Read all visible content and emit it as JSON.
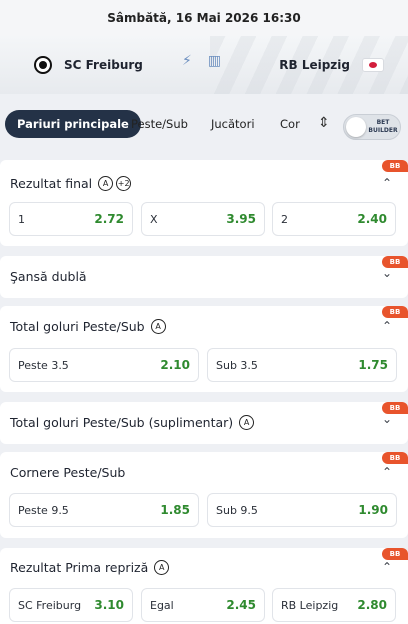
{
  "header": {
    "datetime": "Sâmbătă, 16 Mai 2026 16:30"
  },
  "match": {
    "home_team": "SC Freiburg",
    "away_team": "RB Leipzig",
    "icons": [
      "crest-freiburg-icon",
      "lightning-icon",
      "stats-icon",
      "crest-leipzig-icon"
    ]
  },
  "tabs": {
    "items": [
      "Pariuri principale",
      "Peste/Sub",
      "Jucători",
      "Cor"
    ],
    "active": "Pariuri principale",
    "toggle_label": "BET BUILDER",
    "toggle_on": false
  },
  "badge": "BB",
  "markets": [
    {
      "title": "Rezultat final",
      "expanded": true,
      "icons": [
        "circle-a-icon",
        "plus-2-icon"
      ],
      "plus_label": "+2",
      "outcomes": [
        {
          "label": "1",
          "odds": "2.72"
        },
        {
          "label": "X",
          "odds": "3.95"
        },
        {
          "label": "2",
          "odds": "2.40"
        }
      ]
    },
    {
      "title": "Şansă dublă",
      "expanded": false
    },
    {
      "title": "Total goluri Peste/Sub",
      "expanded": true,
      "outcomes": [
        {
          "label": "Peste 3.5",
          "odds": "2.10"
        },
        {
          "label": "Sub 3.5",
          "odds": "1.75"
        }
      ]
    },
    {
      "title": "Total goluri Peste/Sub (suplimentar)",
      "expanded": false
    },
    {
      "title": "Cornere Peste/Sub",
      "expanded": true,
      "outcomes": [
        {
          "label": "Peste 9.5",
          "odds": "1.85"
        },
        {
          "label": "Sub 9.5",
          "odds": "1.90"
        }
      ]
    },
    {
      "title": "Rezultat Prima repriză",
      "expanded": true,
      "outcomes": [
        {
          "label": "SC Freiburg",
          "odds": "3.10"
        },
        {
          "label": "Egal",
          "odds": "2.45"
        },
        {
          "label": "RB Leipzig",
          "odds": "2.80"
        }
      ]
    }
  ],
  "colors": {
    "odds": "#2f8a2f",
    "badge": "#e8542c",
    "active_tab": "#243247"
  }
}
